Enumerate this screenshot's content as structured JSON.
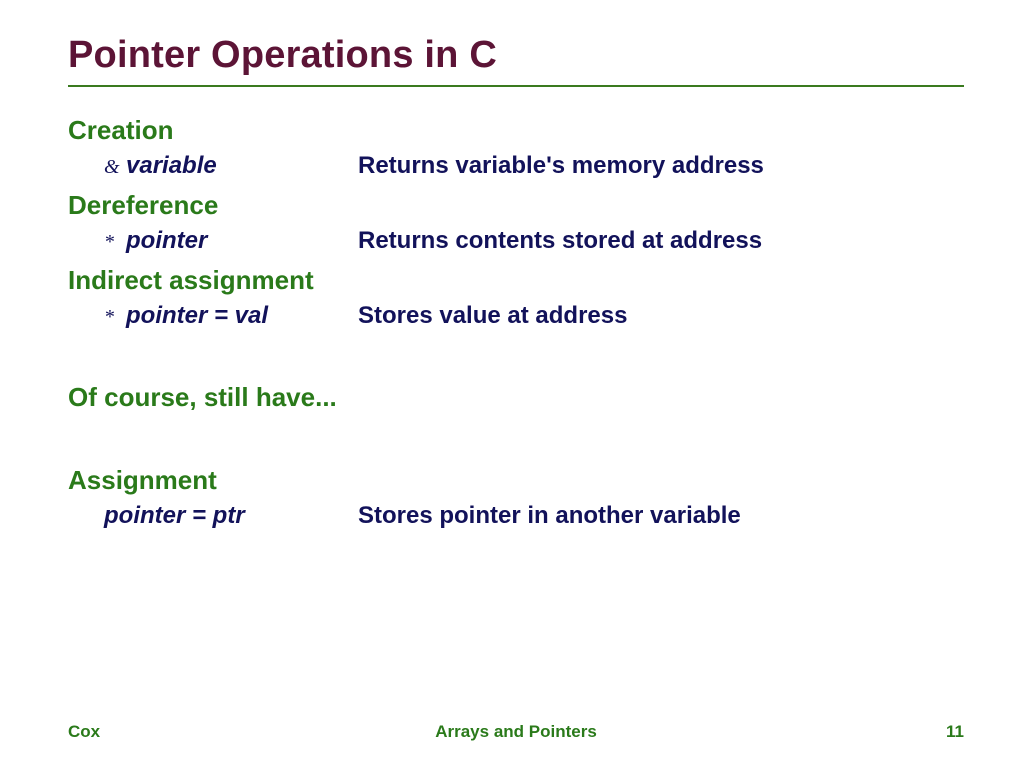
{
  "title": "Pointer Operations in C",
  "sections": {
    "creation": {
      "head": "Creation",
      "op": "&",
      "code": "variable",
      "desc": "Returns variable's memory address"
    },
    "dereference": {
      "head": "Dereference",
      "op": "*",
      "code": "pointer",
      "desc": "Returns contents stored at address"
    },
    "indirect": {
      "head": "Indirect assignment",
      "op": "*",
      "code": "pointer = val",
      "desc": "Stores value at address"
    }
  },
  "note": "Of course, still have...",
  "assignment": {
    "head": "Assignment",
    "code": "pointer = ptr",
    "desc": "Stores pointer in another variable"
  },
  "footer": {
    "left": "Cox",
    "center": "Arrays and Pointers",
    "right": "11"
  }
}
